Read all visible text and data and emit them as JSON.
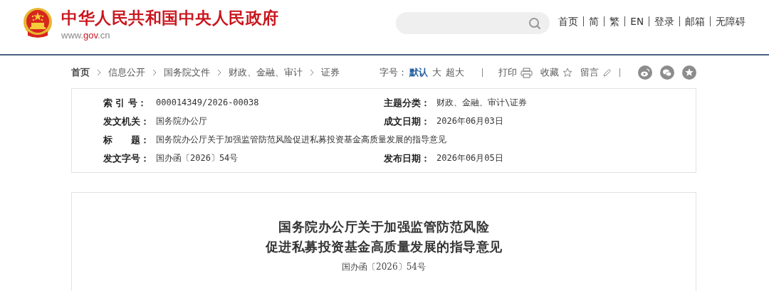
{
  "header": {
    "site_title": "中华人民共和国中央人民政府",
    "site_url": {
      "prefix": "www.",
      "domain": "gov",
      "suffix": ".cn"
    },
    "nav_links": [
      "首页",
      "简",
      "繁",
      "EN",
      "登录",
      "邮箱",
      "无障碍"
    ]
  },
  "breadcrumb": [
    "首页",
    "信息公开",
    "国务院文件",
    "财政、金融、审计",
    "证券"
  ],
  "toolbar": {
    "font_size_label": "字号：",
    "font_sizes": [
      {
        "label": "默认",
        "selected": true
      },
      {
        "label": "大",
        "selected": false
      },
      {
        "label": "超大",
        "selected": false
      }
    ],
    "actions": [
      {
        "label": "打印",
        "kind": "print"
      },
      {
        "label": "收藏",
        "kind": "star"
      },
      {
        "label": "留言",
        "kind": "pencil"
      }
    ]
  },
  "meta": [
    {
      "label": "索 引 号：",
      "value": "000014349/2026-00038",
      "kind": "half"
    },
    {
      "label": "主题分类：",
      "value": "财政、金融、审计\\证券",
      "kind": "half"
    },
    {
      "label": "发文机关：",
      "value": "国务院办公厅",
      "kind": "half"
    },
    {
      "label": "成文日期：",
      "value": "2026年06月03日",
      "kind": "half"
    },
    {
      "label": "标      题：",
      "value": "国务院办公厅关于加强监管防范风险促进私募投资基金高质量发展的指导意见",
      "kind": "wide"
    },
    {
      "label": "发文字号：",
      "value": "国办函〔2026〕54号",
      "kind": "half"
    },
    {
      "label": "发布日期：",
      "value": "2026年06月05日",
      "kind": "half"
    }
  ],
  "document": {
    "title_lines": [
      "国务院办公厅关于加强监管防范风险",
      "促进私募投资基金高质量发展的指导意见"
    ],
    "doc_number": "国办函〔2026〕54号"
  }
}
